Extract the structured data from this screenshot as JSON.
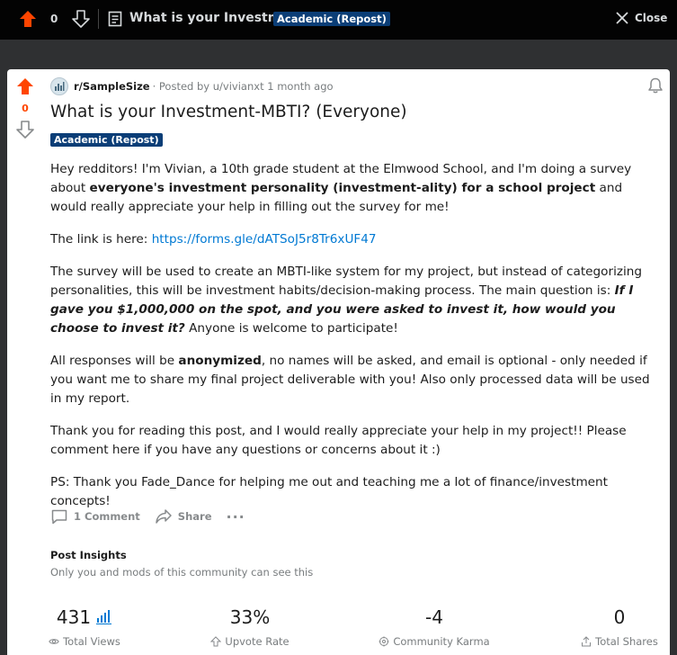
{
  "topbar": {
    "score": "0",
    "title": "What is your Investm...",
    "flair": "Academic (Repost)",
    "close_label": "Close"
  },
  "post": {
    "score": "0",
    "subreddit": "r/SampleSize",
    "posted_by": "· Posted by u/vivianxt 1 month ago",
    "title": "What is your Investment-MBTI? (Everyone)",
    "flair": "Academic (Repost)",
    "body": {
      "p1_a": "Hey redditors! I'm Vivian, a 10th grade student at the Elmwood School, and I'm doing a survey about ",
      "p1_b": "everyone's investment personality (investment-ality) for a school project",
      "p1_c": " and would really appreciate your help in filling out the survey for me!",
      "p2_a": "The link is here: ",
      "p2_link": "https://forms.gle/dATSoJ5r8Tr6xUF47",
      "p3_a": "The survey will be used to create an MBTI-like system for my project, but instead of categorizing personalities, this will be investment habits/decision-making process. The main question is: ",
      "p3_b": "If I gave you $1,000,000 on the spot, and you were asked to invest it, how would you choose to invest it?",
      "p3_c": " Anyone is welcome to participate!",
      "p4_a": "All responses will be ",
      "p4_b": "anonymized",
      "p4_c": ", no names will be asked, and email is optional - only needed if you want me to share my final project deliverable with you! Also only processed data will be used in my report.",
      "p5": "Thank you for reading this post, and I would really appreciate your help in my project!! Please comment here if you have any questions or concerns about it :)",
      "p6": "PS: Thank you Fade_Dance for helping me out and teaching me a lot of finance/investment concepts!"
    },
    "actions": {
      "comments": "1 Comment",
      "share": "Share",
      "more": "···"
    }
  },
  "insights": {
    "title": "Post Insights",
    "subtitle": "Only you and mods of this community can see this",
    "stats": [
      {
        "value": "431",
        "label": "Total Views"
      },
      {
        "value": "33%",
        "label": "Upvote Rate"
      },
      {
        "value": "-4",
        "label": "Community Karma"
      },
      {
        "value": "0",
        "label": "Total Shares"
      }
    ]
  },
  "colors": {
    "upvote": "#ff4500",
    "flair_bg": "#0b3e77",
    "link": "#0079d3",
    "topbar_bg": "#030303",
    "backdrop": "#2f3032"
  },
  "icons": [
    "upvote-arrow-icon",
    "downvote-arrow-icon",
    "document-icon",
    "close-icon",
    "subreddit-icon",
    "bell-icon",
    "comment-icon",
    "share-icon",
    "bar-chart-icon",
    "eye-icon",
    "arrow-up-outline-icon",
    "karma-icon",
    "share-outline-icon"
  ]
}
